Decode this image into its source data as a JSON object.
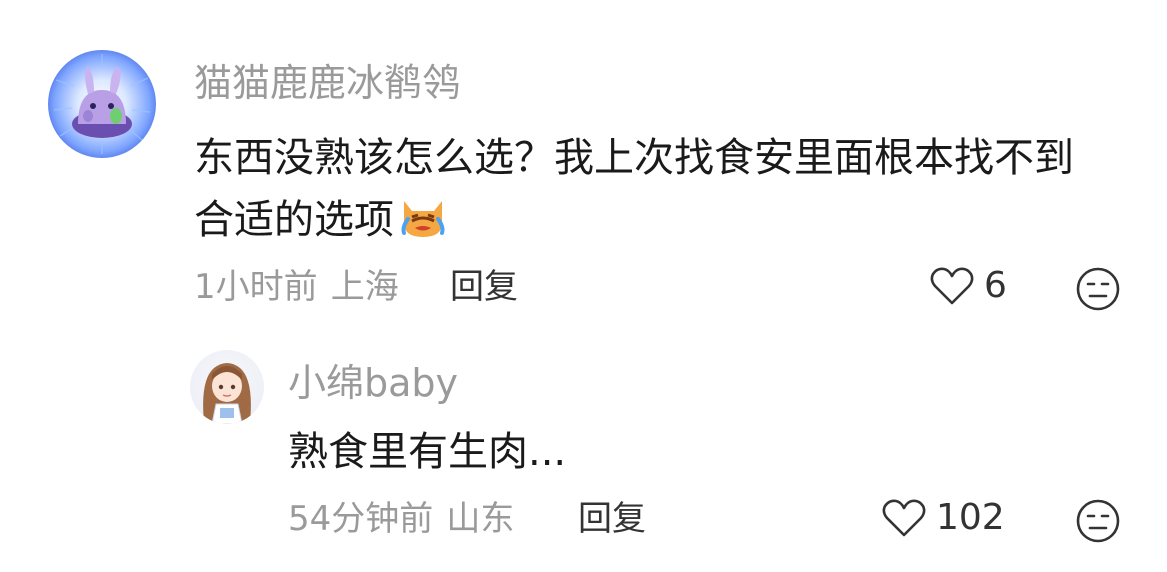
{
  "comment": {
    "username": "猫猫鹿鹿冰鹡鸰",
    "text_line1": "东西没熟该怎么选？我上次找食安里面根本找不到",
    "text_line2": "合适的选项",
    "emoji_icon": "crying-cat-emoji-icon",
    "time": "1小时前",
    "location": "上海",
    "reply_label": "回复",
    "likes": "6",
    "like_icon": "heart-outline-icon",
    "dislike_icon": "neutral-face-icon"
  },
  "reply": {
    "username": "小绵baby",
    "text": "熟食里有生肉...",
    "time": "54分钟前",
    "location": "山东",
    "reply_label": "回复",
    "likes": "102",
    "like_icon": "heart-outline-icon",
    "dislike_icon": "neutral-face-icon"
  },
  "colors": {
    "secondary_text": "#9a9a9a",
    "primary_text": "#1a1a1a",
    "action_text": "#333333"
  }
}
